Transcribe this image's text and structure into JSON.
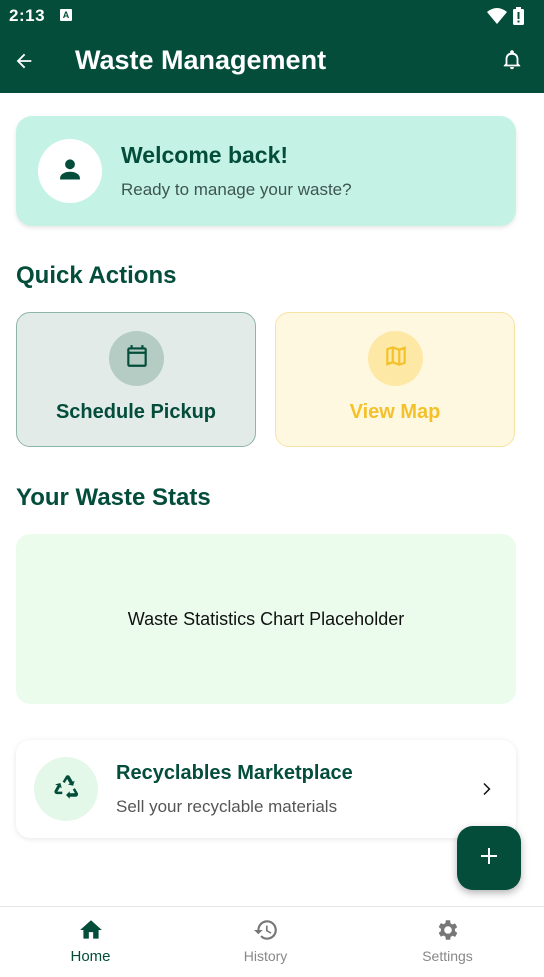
{
  "status_bar": {
    "time": "2:13",
    "notification_letter": "A"
  },
  "app_bar": {
    "title": "Waste Management",
    "back_icon": "arrow-left-icon",
    "action_icon": "bell-icon"
  },
  "welcome": {
    "title": "Welcome back!",
    "subtitle": "Ready to manage your waste?",
    "avatar_icon": "person-icon"
  },
  "quick_actions": {
    "title": "Quick Actions",
    "items": [
      {
        "label": "Schedule Pickup",
        "icon": "calendar-icon",
        "color": "#034d3a"
      },
      {
        "label": "View Map",
        "icon": "map-icon",
        "color": "#f4c12a"
      }
    ]
  },
  "stats": {
    "title": "Your Waste Stats",
    "placeholder": "Waste Statistics Chart Placeholder"
  },
  "marketplace": {
    "title": "Recyclables Marketplace",
    "subtitle": "Sell your recyclable materials",
    "icon": "recycle-icon"
  },
  "fab": {
    "icon": "plus-icon"
  },
  "bottom_nav": {
    "items": [
      {
        "label": "Home",
        "icon": "home-icon",
        "active": true
      },
      {
        "label": "History",
        "icon": "history-icon",
        "active": false
      },
      {
        "label": "Settings",
        "icon": "gear-icon",
        "active": false
      }
    ]
  },
  "colors": {
    "primary": "#034d3a",
    "accent_mint": "#c4f3e6",
    "accent_yellow": "#f4c12a"
  }
}
